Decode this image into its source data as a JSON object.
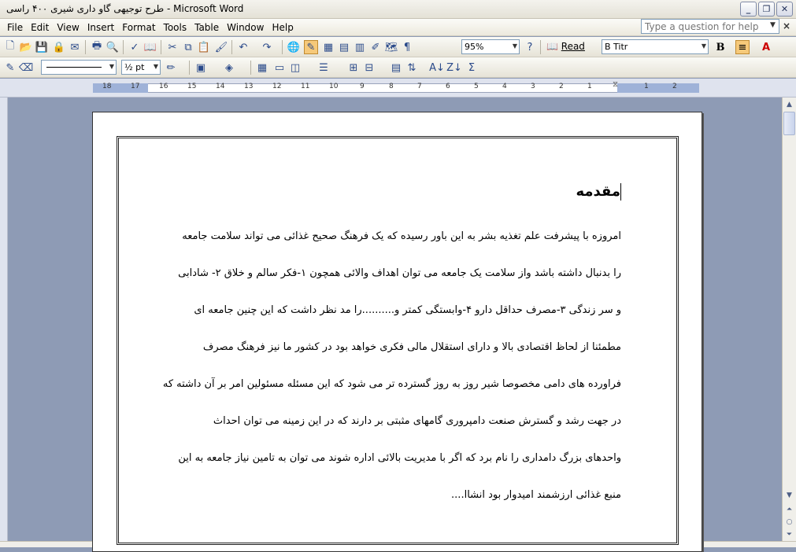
{
  "window": {
    "title": "طرح توجیهی گاو داری شیری ۴۰۰ راسی - Microsoft Word",
    "minimize": "_",
    "restore": "❐",
    "close": "✕"
  },
  "menu": [
    {
      "label": "File"
    },
    {
      "label": "Edit"
    },
    {
      "label": "View"
    },
    {
      "label": "Insert"
    },
    {
      "label": "Format"
    },
    {
      "label": "Tools"
    },
    {
      "label": "Table"
    },
    {
      "label": "Window"
    },
    {
      "label": "Help"
    }
  ],
  "help_box": {
    "placeholder": "Type a question for help"
  },
  "toolbar": {
    "zoom": "95%",
    "read_label": "Read",
    "font_name": "B Titr",
    "bold_label": "B",
    "line_weight": "½ pt"
  },
  "ruler": {
    "numbers": [
      "18",
      "17",
      "16",
      "15",
      "14",
      "13",
      "12",
      "11",
      "10",
      "9",
      "8",
      "7",
      "6",
      "5",
      "4",
      "3",
      "2",
      "1",
      "1",
      "2"
    ]
  },
  "document": {
    "heading": "مقدمه",
    "lines": [
      "امروزه با پیشرفت علم تغذیه بشر به این باور رسیده که یک فرهنگ صحیح غذائی می تواند  سلامت جامعه",
      "را بدنبال داشته باشد واز سلامت یک جامعه می توان اهداف والائی همچون ۱-فکر سالم و خلاق ۲- شادابی",
      "و سر زندگی  ۳-مصرف حداقل دارو ۴-وابستگی کمتر و..........را مد نظر داشت که این چنین جامعه ای",
      "مطمئنا از لحاظ اقتصادی بالا و دارای استقلال مالی فکری خواهد بود در کشور ما نیز فرهنگ مصرف",
      "فراورده های دامی مخصوصا شیر روز به روز گسترده تر می شود که این مسئله مسئولین امر بر آن داشته که",
      "در جهت رشد و گسترش صنعت دامپروری گامهای مثبتی بر دارند که در این زمینه می توان احداث",
      "واحدهای بزرگ دامداری را نام برد که اگر با مدیریت بالائی اداره شوند می توان به تامین نیاز جامعه به این",
      "منبع غذائی ارزشمند امیدوار بود انشاا...."
    ]
  }
}
